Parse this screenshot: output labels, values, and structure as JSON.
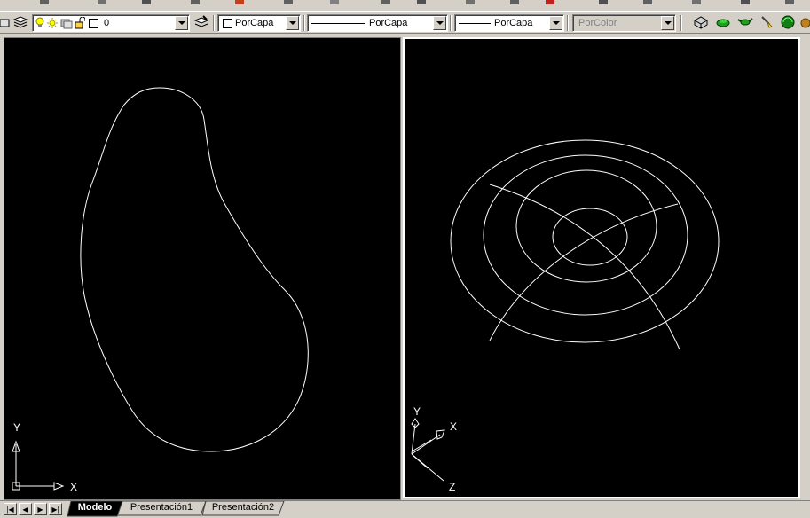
{
  "toolbar": {
    "layer": {
      "value": "0"
    },
    "color": {
      "value": "PorCapa"
    },
    "linetype": {
      "value": "PorCapa"
    },
    "lineweight": {
      "value": "PorCapa"
    },
    "plotstyle": {
      "value": "PorColor"
    }
  },
  "viewports": {
    "left": {
      "ucs_y": "Y",
      "ucs_x": "X"
    },
    "right": {
      "ucs_y": "Y",
      "ucs_x": "X",
      "ucs_z": "Z"
    }
  },
  "tabs": {
    "items": [
      {
        "label": "Modelo",
        "active": true
      },
      {
        "label": "Presentación1",
        "active": false
      },
      {
        "label": "Presentación2",
        "active": false
      }
    ]
  },
  "colors": {
    "background": "#000000",
    "drawing_line": "#ffffff",
    "ui_face": "#d4d0c8"
  }
}
